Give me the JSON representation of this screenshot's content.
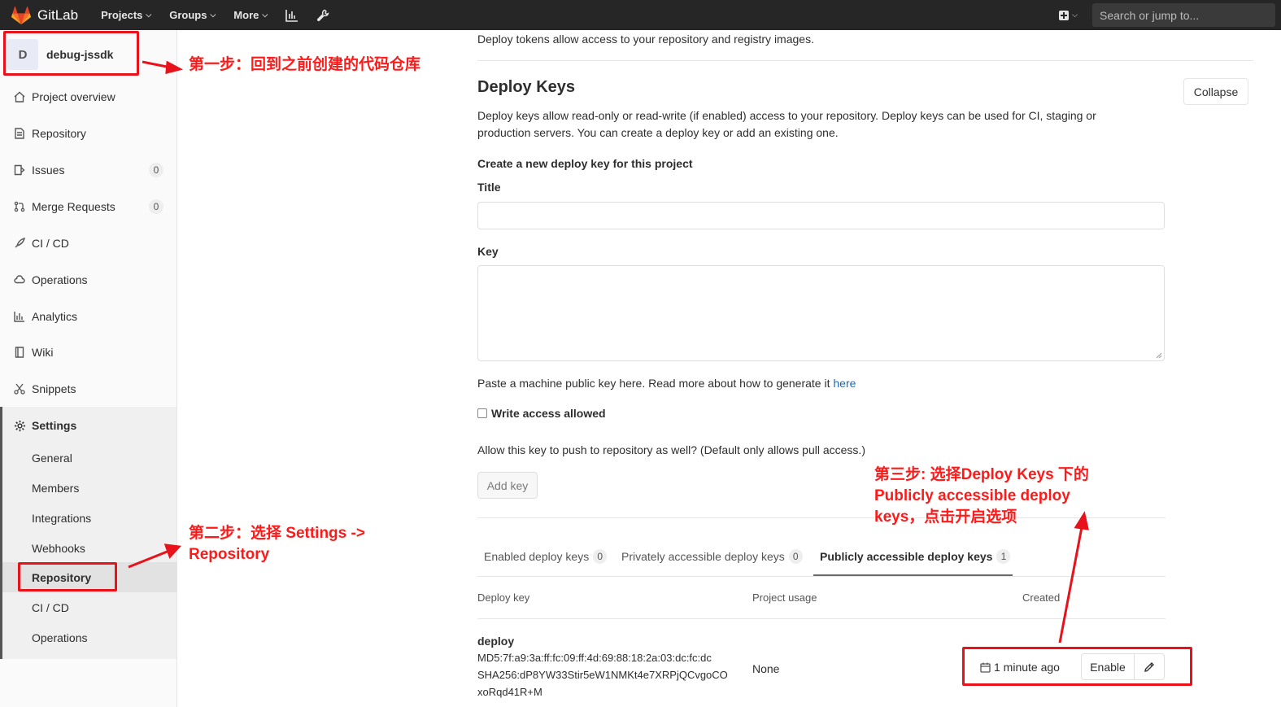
{
  "navbar": {
    "brand": "GitLab",
    "projects": "Projects",
    "groups": "Groups",
    "more": "More",
    "search_placeholder": "Search or jump to..."
  },
  "sidebar": {
    "avatar_letter": "D",
    "project_name": "debug-jssdk",
    "items": [
      {
        "label": "Project overview",
        "icon": "home-icon"
      },
      {
        "label": "Repository",
        "icon": "doc-icon"
      },
      {
        "label": "Issues",
        "icon": "issues-icon",
        "count": "0"
      },
      {
        "label": "Merge Requests",
        "icon": "merge-icon",
        "count": "0"
      },
      {
        "label": "CI / CD",
        "icon": "rocket-icon"
      },
      {
        "label": "Operations",
        "icon": "cloud-icon"
      },
      {
        "label": "Analytics",
        "icon": "chart-icon"
      },
      {
        "label": "Wiki",
        "icon": "book-icon"
      },
      {
        "label": "Snippets",
        "icon": "scissors-icon"
      },
      {
        "label": "Settings",
        "icon": "gear-icon"
      }
    ],
    "settings_sub": [
      "General",
      "Members",
      "Integrations",
      "Webhooks",
      "Repository",
      "CI / CD",
      "Operations"
    ]
  },
  "main": {
    "tokens_text": "Deploy tokens allow access to your repository and registry images.",
    "deploy_keys_title": "Deploy Keys",
    "collapse": "Collapse",
    "description": "Deploy keys allow read-only or read-write (if enabled) access to your repository. Deploy keys can be used for CI, staging or production servers. You can create a deploy key or add an existing one.",
    "create_heading": "Create a new deploy key for this project",
    "title_label": "Title",
    "key_label": "Key",
    "help_text": "Paste a machine public key here. Read more about how to generate it ",
    "help_link": "here",
    "write_access": "Write access allowed",
    "allow_text": "Allow this key to push to repository as well? (Default only allows pull access.)",
    "add_key": "Add key",
    "tabs": [
      {
        "label": "Enabled deploy keys",
        "count": "0"
      },
      {
        "label": "Privately accessible deploy keys",
        "count": "0"
      },
      {
        "label": "Publicly accessible deploy keys",
        "count": "1"
      }
    ],
    "table": {
      "col_key": "Deploy key",
      "col_usage": "Project usage",
      "col_created": "Created",
      "row": {
        "name": "deploy",
        "md5": "MD5:7f:a9:3a:ff:fc:09:ff:4d:69:88:18:2a:03:dc:fc:dc",
        "sha_line1": "SHA256:dP8YW33Stir5eW1NMKt4e7XRPjQCvgoCO",
        "sha_line2": "xoRqd41R+M",
        "usage": "None",
        "created": "1 minute ago",
        "enable": "Enable"
      }
    }
  },
  "annotations": {
    "step1": "第一步：回到之前创建的代码仓库",
    "step2": "第二步：选择 Settings -> Repository",
    "step3": "第三步: 选择Deploy Keys 下的 Publicly accessible deploy keys，点击开启选项",
    "color": "#e8121a"
  }
}
